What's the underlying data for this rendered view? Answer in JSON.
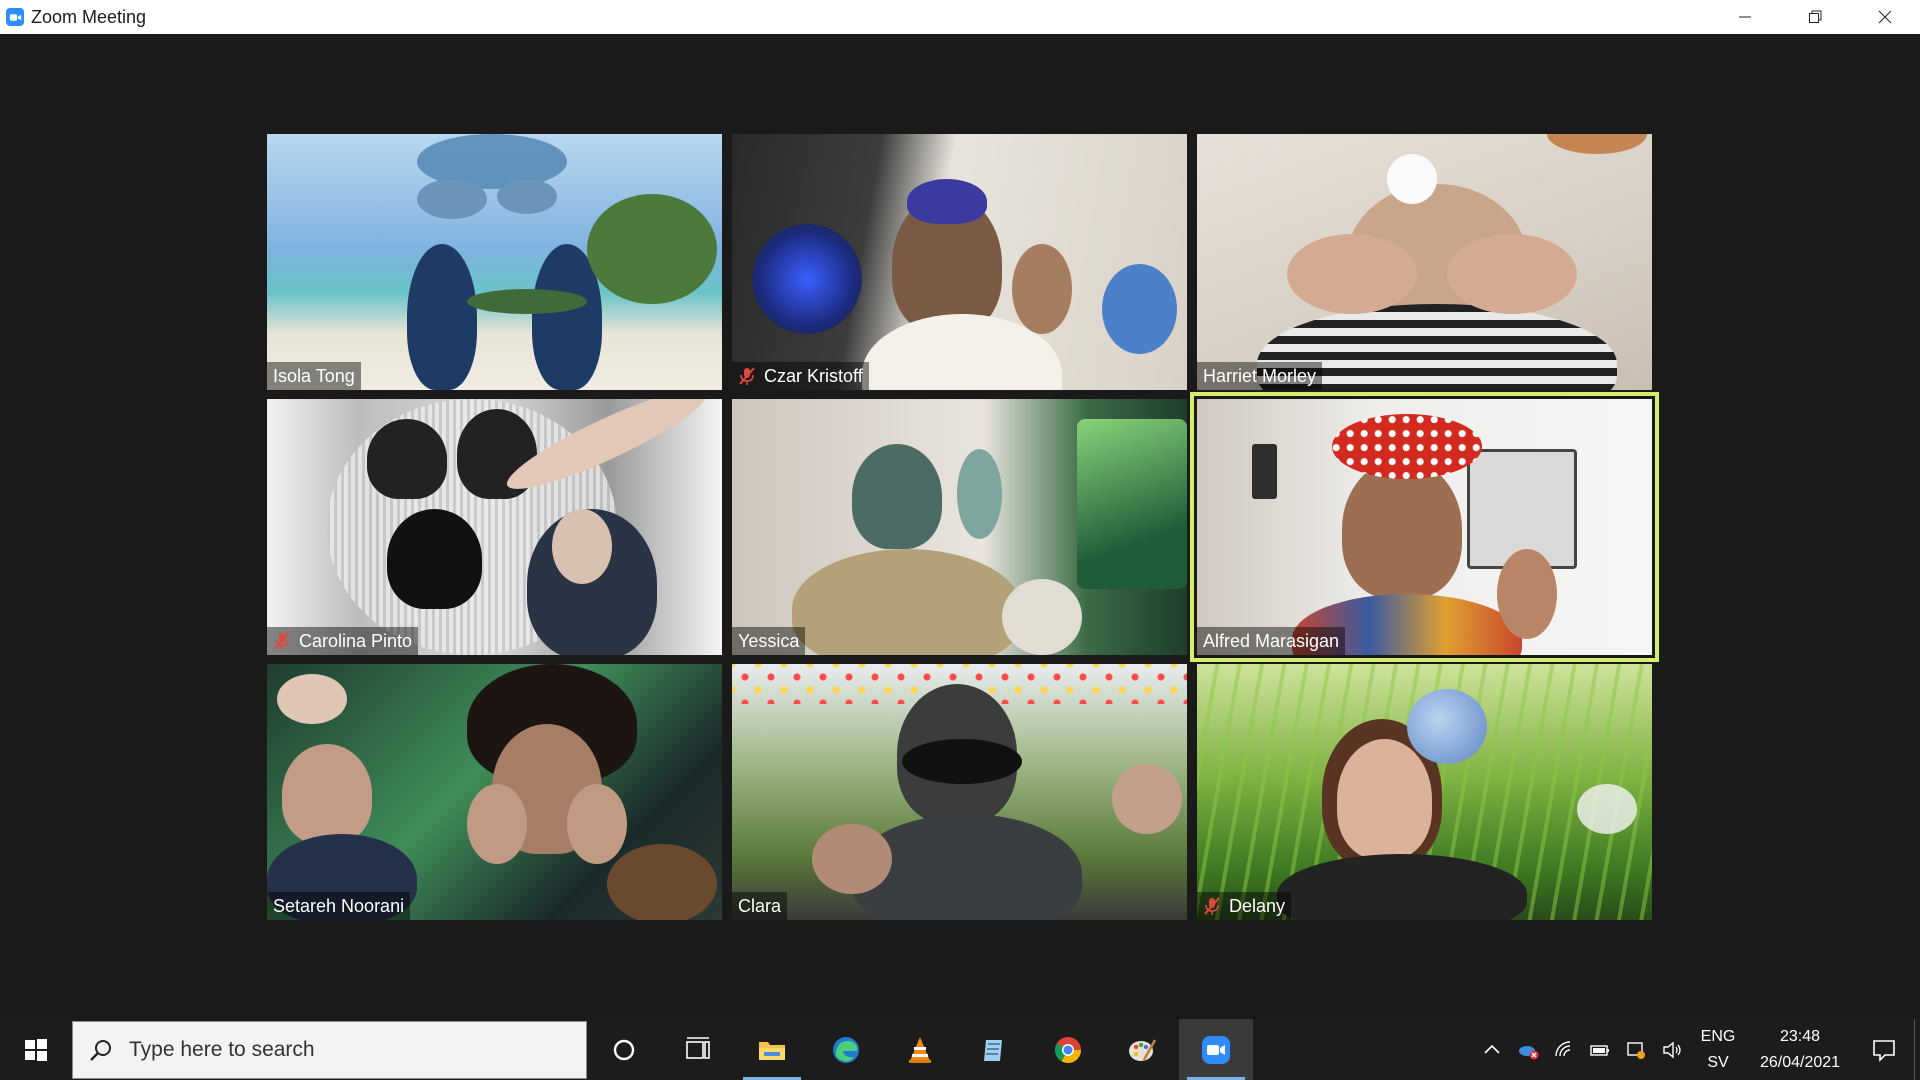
{
  "window": {
    "title": "Zoom Meeting"
  },
  "participants": [
    {
      "name": "Isola Tong",
      "muted": false,
      "active": false
    },
    {
      "name": "Czar Kristoff",
      "muted": true,
      "active": false
    },
    {
      "name": "Harriet Morley",
      "muted": false,
      "active": false
    },
    {
      "name": "Carolina Pinto",
      "muted": true,
      "active": false
    },
    {
      "name": "Yessica",
      "muted": false,
      "active": false
    },
    {
      "name": "Alfred Marasigan",
      "muted": false,
      "active": true
    },
    {
      "name": "Setareh Noorani",
      "muted": false,
      "active": false
    },
    {
      "name": "Clara",
      "muted": false,
      "active": false
    },
    {
      "name": "Delany",
      "muted": true,
      "active": false
    }
  ],
  "colors": {
    "active_speaker_border": "#d6ef6b",
    "muted_icon": "#e0483e",
    "zoom_blue": "#2d8cff"
  },
  "taskbar": {
    "search_placeholder": "Type here to search",
    "pinned": [
      "cortana-icon",
      "task-view-icon",
      "file-explorer-icon",
      "edge-icon",
      "vlc-icon",
      "notepad-icon",
      "chrome-icon",
      "paint-icon",
      "zoom-icon"
    ],
    "language_top": "ENG",
    "language_bottom": "SV",
    "time": "23:48",
    "date": "26/04/2021"
  }
}
